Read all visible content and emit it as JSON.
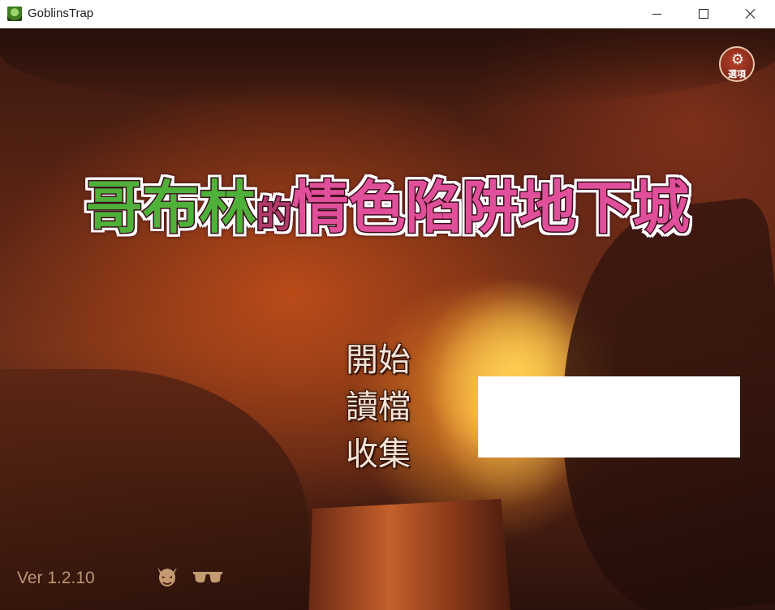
{
  "window": {
    "title": "GoblinsTrap",
    "icon": "goblin-app-icon",
    "controls": {
      "minimize_icon": "minimize-icon",
      "maximize_icon": "maximize-icon",
      "close_icon": "close-icon"
    }
  },
  "game": {
    "logo": {
      "part1": "哥布林",
      "part2": "的",
      "part3": "情色陷阱地下城",
      "colors": {
        "green": "#4fb03a",
        "pink": "#e0509a",
        "outline": "#3b0b1a"
      }
    },
    "menu": {
      "items": [
        "開始",
        "讀檔",
        "收集"
      ]
    },
    "settings": {
      "icon": "gear-icon",
      "label": "選項"
    },
    "footer": {
      "version": "Ver 1.2.10",
      "icons": [
        "devil-icon",
        "sunglasses-icon"
      ]
    }
  }
}
